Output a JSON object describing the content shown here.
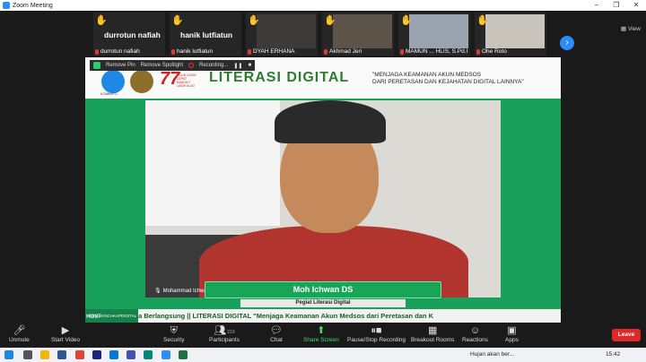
{
  "window": {
    "title": "Zoom Meeting",
    "buttons": [
      "−",
      "❐",
      "✕"
    ]
  },
  "strip": {
    "tiles": [
      {
        "big_name": "durrotun nafiah",
        "label": "durrotun nafiah"
      },
      {
        "big_name": "hanik lutfiatun",
        "label": "hanik lutfiatun"
      },
      {
        "big_name": "",
        "label": "DYAH ERHANA"
      },
      {
        "big_name": "",
        "label": "Akhmad Jeri"
      },
      {
        "big_name": "",
        "label": "MAMUN ... HLIS, S.Pd.I"
      },
      {
        "big_name": "",
        "label": "Ohe Roto"
      }
    ],
    "next_icon": "›",
    "view_label": "View"
  },
  "main": {
    "host_bar": {
      "item1": "Remove Pin",
      "item2": "Remove Spotlight",
      "item3": "Recording..."
    },
    "header": {
      "kominfo": "KOMINFO",
      "seventy": "77",
      "seventy_sub": "PULIH LEBIH CEPAT BANGKIT LEBIH KUAT",
      "title": "LITERASI DIGITAL",
      "quote_line1": "\"MENJAGA KEAMANAN AKUN MEDSOS",
      "quote_line2": "DARI PERETASAN DAN KEJAHATAN DIGITAL LAINNYA\""
    },
    "speaker_label": "Mohammad Ichwan",
    "lower_third": {
      "name": "Moh Ichwan DS",
      "role": "Pegiat Literasi Digital"
    },
    "hashtag": "#SEMAKINCAKAPDIGITAL",
    "ticker": "ara Berlangsung || LITERASI DIGITAL \"Menjaga Keamanan Akun Medsos dari Peretasan dan K",
    "host_tag": "HOST"
  },
  "toolbar": {
    "unmute": "Unmute",
    "start_video": "Start Video",
    "security": "Security",
    "participants": "Participants",
    "participants_count": "219",
    "chat": "Chat",
    "share_screen": "Share Screen",
    "record": "Pause/Stop Recording",
    "breakout": "Breakout Rooms",
    "reactions": "Reactions",
    "apps": "Apps",
    "leave": "Leave"
  },
  "taskbar": {
    "notification": "Hujan akan ber...",
    "time": "15:42"
  },
  "colors": {
    "zoom_blue": "#2d8cff",
    "leave_red": "#e02828",
    "share_green": "#4cd964",
    "literasi_green": "#18a558"
  }
}
